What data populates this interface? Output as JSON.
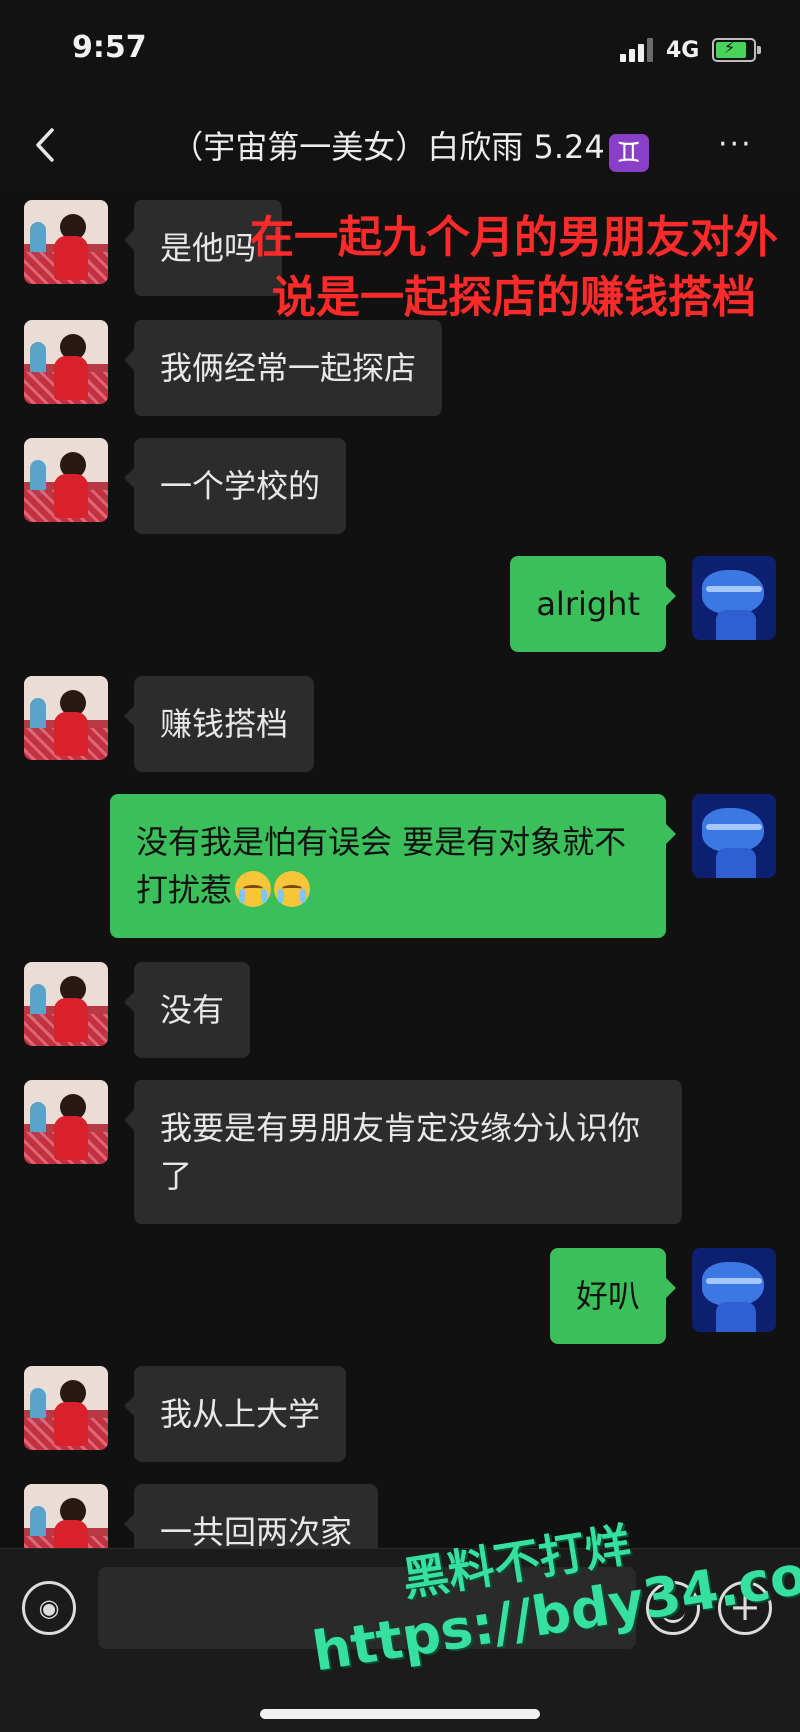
{
  "status_bar": {
    "time": "9:57",
    "network": "4G"
  },
  "header": {
    "title": "（宇宙第一美女）白欣雨 5.24",
    "zodiac_badge": "♊",
    "more": "···",
    "back": "‹"
  },
  "overlay_caption": "在一起九个月的男朋友对外说是一起探店的赚钱搭档",
  "messages": [
    {
      "from": "her",
      "text": "是他吗"
    },
    {
      "from": "her",
      "text": "我俩经常一起探店"
    },
    {
      "from": "her",
      "text": "一个学校的"
    },
    {
      "from": "me",
      "text": "alright"
    },
    {
      "from": "her",
      "text": "赚钱搭档"
    },
    {
      "from": "me",
      "text": "没有我是怕有误会 要是有对象就不打扰惹"
    },
    {
      "from": "her",
      "text": "没有"
    },
    {
      "from": "her",
      "text": "我要是有男朋友肯定没缘分认识你了"
    },
    {
      "from": "me",
      "text": "好叭"
    },
    {
      "from": "her",
      "text": "我从上大学"
    },
    {
      "from": "her",
      "text": "一共回两次家"
    }
  ],
  "input_bar": {
    "placeholder": ""
  },
  "watermark": {
    "line1": "黑料不打烊",
    "line2": "https://bdy34.co"
  },
  "colors": {
    "background": "#111111",
    "bubble_in": "#2c2c2c",
    "bubble_out": "#3bbf5a",
    "overlay_text": "#ff2a2a",
    "watermark": "#36e0a0"
  }
}
